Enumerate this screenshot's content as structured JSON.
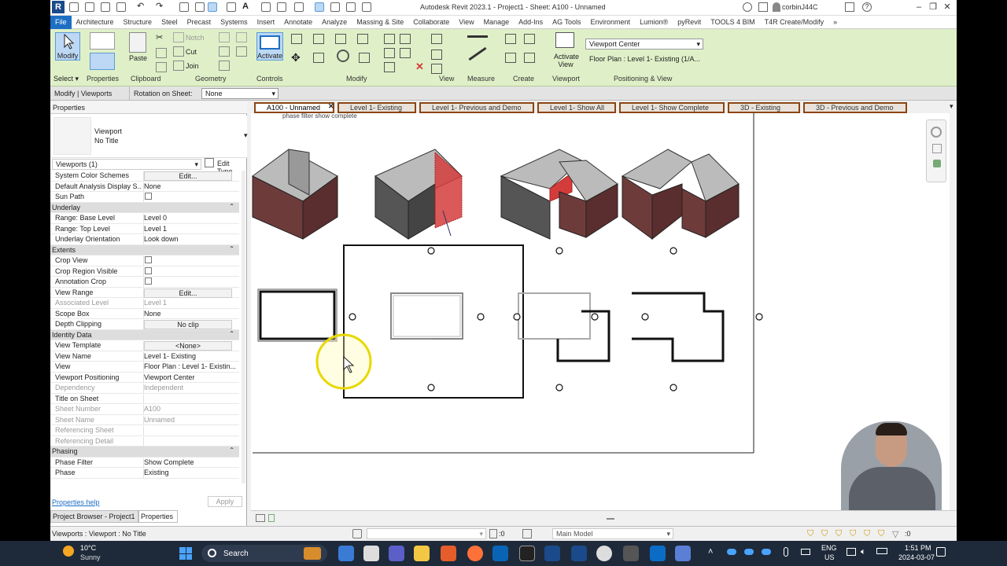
{
  "title_bar": {
    "window_title": "Autodesk Revit 2023.1 - Project1 - Sheet: A100 - Unnamed",
    "user": "corbinJ44C",
    "logo_letter": "R"
  },
  "menu": [
    "File",
    "Architecture",
    "Structure",
    "Steel",
    "Precast",
    "Systems",
    "Insert",
    "Annotate",
    "Analyze",
    "Massing & Site",
    "Collaborate",
    "View",
    "Manage",
    "Add-Ins",
    "AG Tools",
    "Environment",
    "Lumion®",
    "pyRevit",
    "TOOLS 4 BIM",
    "T4R Create/Modify"
  ],
  "ribbon": {
    "modify_label": "Modify",
    "select_label": "Select ▾",
    "properties_label": "Properties",
    "paste_label": "Paste",
    "clipboard_label": "Clipboard",
    "notch_label": "Notch",
    "cut_label": "Cut",
    "join_label": "Join",
    "geometry_label": "Geometry",
    "activate_label": "Activate",
    "controls_label": "Controls",
    "modify_group_label": "Modify",
    "view_group_label": "View",
    "measure_group_label": "Measure",
    "create_group_label": "Create",
    "activate_view_label": "Activate View",
    "viewport_group_label": "Viewport",
    "viewport_position": "Viewport Center",
    "floor_plan_select": "Floor Plan : Level 1- Existing (1/A...",
    "positioning_label": "Positioning & View"
  },
  "options_bar": {
    "context": "Modify | Viewports",
    "rotation_label": "Rotation on Sheet:",
    "rotation_value": "None"
  },
  "properties": {
    "header": "Properties",
    "type_name": "Viewport",
    "type_sub": "No Title",
    "selector": "Viewports (1)",
    "edit_type": "Edit Type",
    "rows": [
      {
        "k": "System Color Schemes",
        "v": "Edit...",
        "kind": "btn"
      },
      {
        "k": "Default Analysis Display S...",
        "v": "None"
      },
      {
        "k": "Sun Path",
        "v": "",
        "kind": "cb"
      },
      {
        "k": "Underlay",
        "v": "",
        "kind": "sec"
      },
      {
        "k": "Range: Base Level",
        "v": "Level 0"
      },
      {
        "k": "Range: Top Level",
        "v": "Level 1"
      },
      {
        "k": "Underlay Orientation",
        "v": "Look down"
      },
      {
        "k": "Extents",
        "v": "",
        "kind": "sec"
      },
      {
        "k": "Crop View",
        "v": "",
        "kind": "cb"
      },
      {
        "k": "Crop Region Visible",
        "v": "",
        "kind": "cb"
      },
      {
        "k": "Annotation Crop",
        "v": "",
        "kind": "cb"
      },
      {
        "k": "View Range",
        "v": "Edit...",
        "kind": "btn"
      },
      {
        "k": "Associated Level",
        "v": "Level 1",
        "kind": "dis"
      },
      {
        "k": "Scope Box",
        "v": "None"
      },
      {
        "k": "Depth Clipping",
        "v": "No clip",
        "kind": "btn"
      },
      {
        "k": "Identity Data",
        "v": "",
        "kind": "sec"
      },
      {
        "k": "View Template",
        "v": "<None>",
        "kind": "btn"
      },
      {
        "k": "View Name",
        "v": "Level 1- Existing"
      },
      {
        "k": "View",
        "v": "Floor Plan : Level 1- Existin..."
      },
      {
        "k": "Viewport Positioning",
        "v": "Viewport Center"
      },
      {
        "k": "Dependency",
        "v": "Independent",
        "kind": "dis"
      },
      {
        "k": "Title on Sheet",
        "v": ""
      },
      {
        "k": "Sheet Number",
        "v": "A100",
        "kind": "dis"
      },
      {
        "k": "Sheet Name",
        "v": "Unnamed",
        "kind": "dis"
      },
      {
        "k": "Referencing Sheet",
        "v": "",
        "kind": "dis"
      },
      {
        "k": "Referencing Detail",
        "v": "",
        "kind": "dis"
      },
      {
        "k": "Phasing",
        "v": "",
        "kind": "sec"
      },
      {
        "k": "Phase Filter",
        "v": "Show Complete"
      },
      {
        "k": "Phase",
        "v": "Existing"
      }
    ],
    "help": "Properties help",
    "apply": "Apply",
    "tab_browser": "Project Browser - Project1",
    "tab_props": "Properties"
  },
  "tabs": [
    "A100 - Unnamed",
    "Level 1- Existing",
    "Level 1- Previous and Demo",
    "Level 1- Show All",
    "Level 1- Show Complete",
    "3D - Existing",
    "3D - Previous and Demo"
  ],
  "canvas": {
    "caption": "phase filter show complete"
  },
  "status": {
    "left": "Viewports : Viewport : No Title",
    "model": "Main Model",
    "zero": ":0"
  },
  "taskbar": {
    "temp": "10°C",
    "weather": "Sunny",
    "search": "Search",
    "lang1": "ENG",
    "lang2": "US",
    "time": "1:51 PM",
    "date": "2024-03-07"
  },
  "colors": {
    "accent": "#1c6fc4",
    "ribbon": "#dff0c8",
    "brick": "#6e3b3b",
    "demo": "#d43c3c",
    "tab_border": "#8b4513"
  }
}
